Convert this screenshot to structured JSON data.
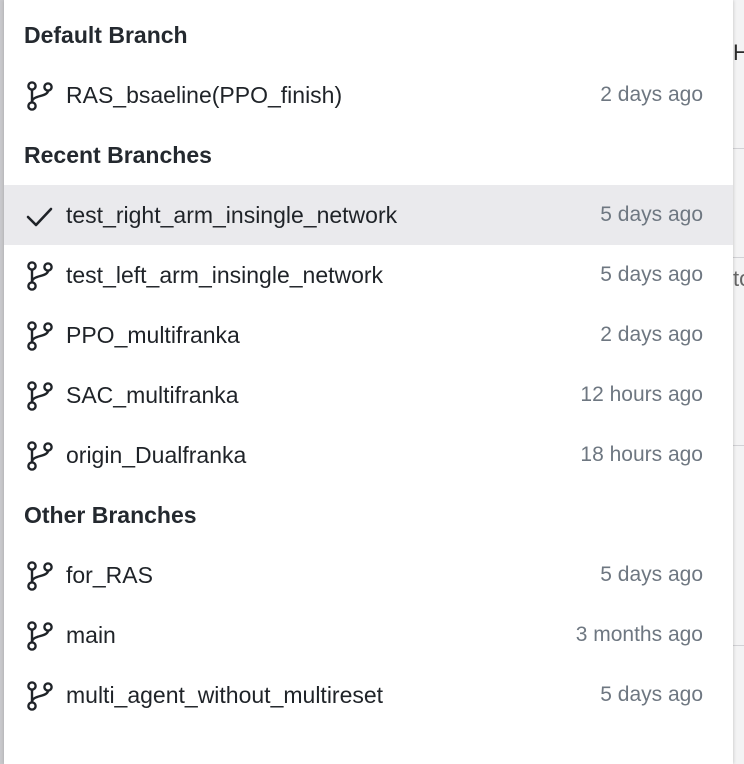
{
  "background": {
    "glimpse_text_1": "He",
    "glimpse_text_2": "to"
  },
  "sections": {
    "default": {
      "heading": "Default Branch",
      "items": [
        {
          "name": "RAS_bsaeline(PPO_finish)",
          "time": "2 days ago",
          "icon": "git-branch-icon"
        }
      ]
    },
    "recent": {
      "heading": "Recent Branches",
      "items": [
        {
          "name": "test_right_arm_insingle_network",
          "time": "5 days ago",
          "icon": "checkmark-icon",
          "selected": true
        },
        {
          "name": "test_left_arm_insingle_network",
          "time": "5 days ago",
          "icon": "git-branch-icon"
        },
        {
          "name": "PPO_multifranka",
          "time": "2 days ago",
          "icon": "git-branch-icon"
        },
        {
          "name": "SAC_multifranka",
          "time": "12 hours ago",
          "icon": "git-branch-icon"
        },
        {
          "name": "origin_Dualfranka",
          "time": "18 hours ago",
          "icon": "git-branch-icon"
        }
      ]
    },
    "other": {
      "heading": "Other Branches",
      "items": [
        {
          "name": "for_RAS",
          "time": "5 days ago",
          "icon": "git-branch-icon"
        },
        {
          "name": "main",
          "time": "3 months ago",
          "icon": "git-branch-icon"
        },
        {
          "name": "multi_agent_without_multireset",
          "time": "5 days ago",
          "icon": "git-branch-icon"
        }
      ]
    }
  },
  "colors": {
    "selected_row_bg": "#eaeaed",
    "time_text": "#6e7781",
    "heading_text": "#24292f"
  }
}
